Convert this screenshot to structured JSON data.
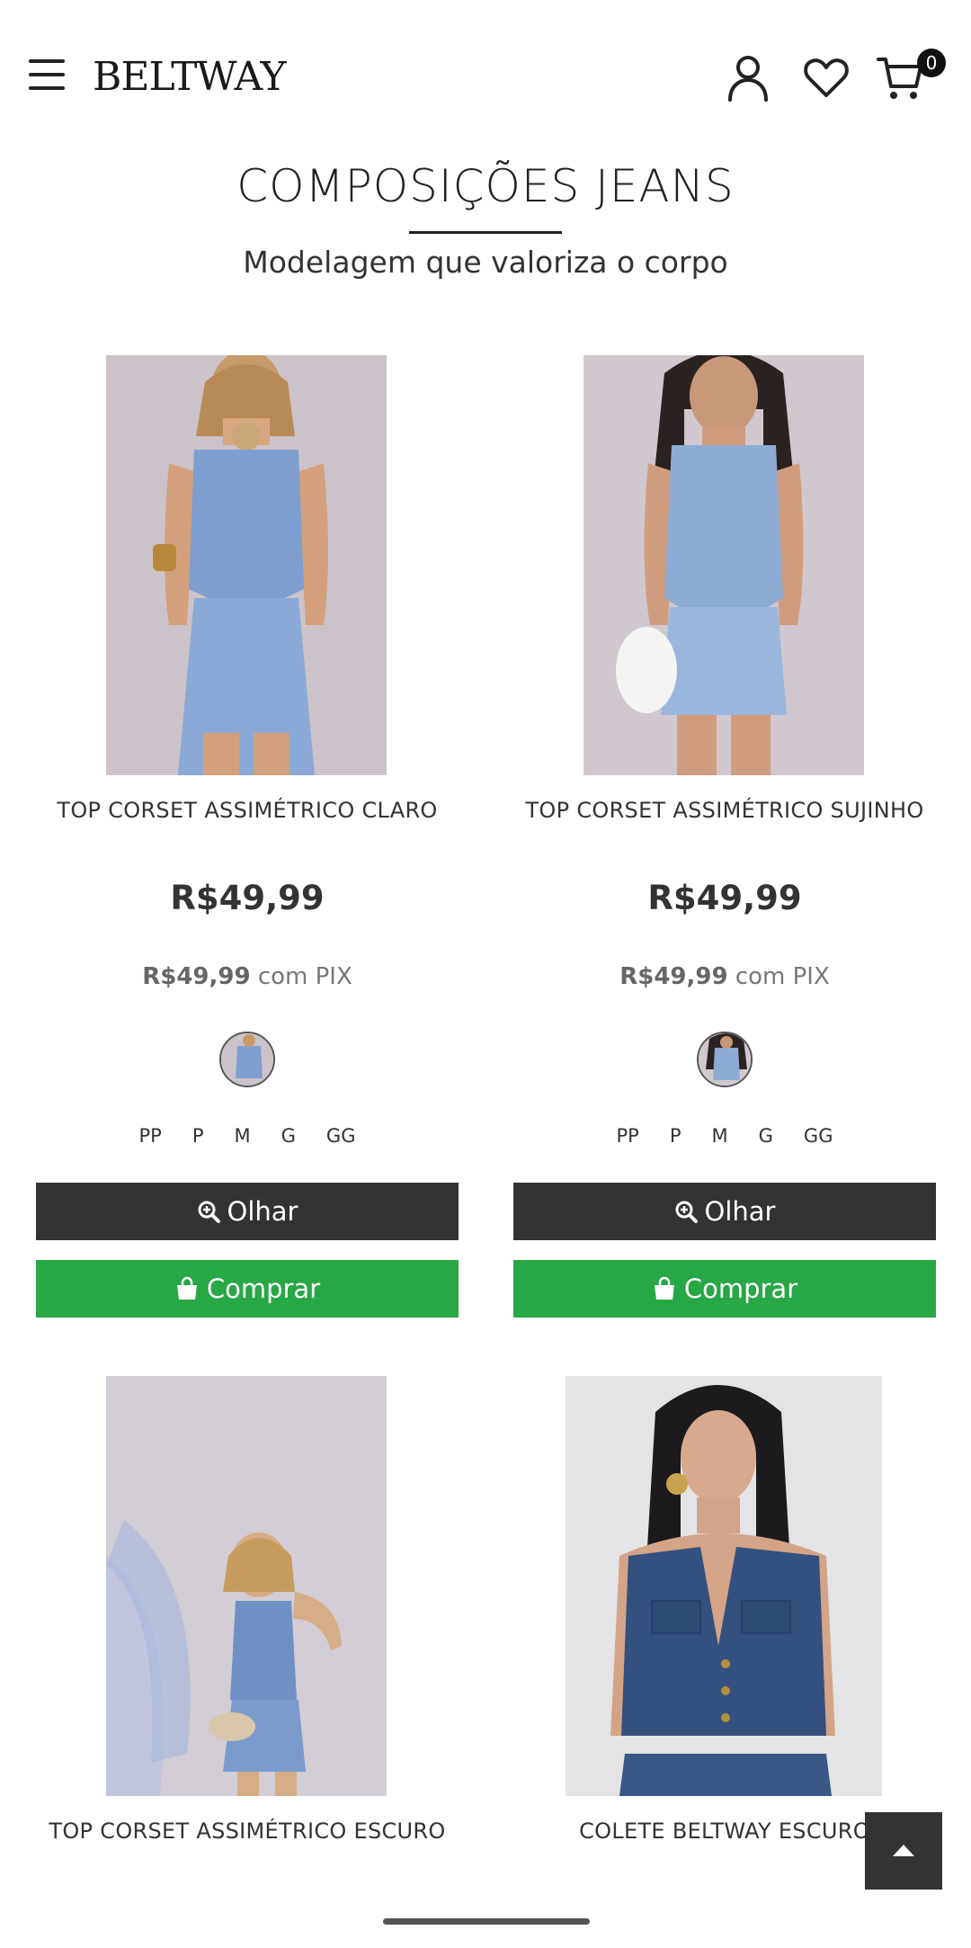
{
  "header": {
    "logo": "BELTWAY",
    "cart_count": "0"
  },
  "section": {
    "title": "COMPOSIÇÕES JEANS",
    "subtitle": "Modelagem que valoriza o corpo"
  },
  "products": [
    {
      "name": "TOP CORSET ASSIMÉTRICO CLARO",
      "price": "R$49,99",
      "pix_price": "R$49,99",
      "pix_suffix": "com PIX",
      "sizes": [
        "PP",
        "P",
        "M",
        "G",
        "GG"
      ],
      "olhar_label": "Olhar",
      "comprar_label": "Comprar"
    },
    {
      "name": "TOP CORSET ASSIMÉTRICO SUJINHO",
      "price": "R$49,99",
      "pix_price": "R$49,99",
      "pix_suffix": "com PIX",
      "sizes": [
        "PP",
        "P",
        "M",
        "G",
        "GG"
      ],
      "olhar_label": "Olhar",
      "comprar_label": "Comprar"
    },
    {
      "name": "TOP CORSET ASSIMÉTRICO ESCURO"
    },
    {
      "name": "COLETE BELTWAY ESCURO"
    }
  ],
  "colors": {
    "dark_button": "#333333",
    "buy_button": "#28a745",
    "denim_light": "#7e9fd0",
    "denim_dark": "#34507e"
  },
  "icons": [
    "menu-icon",
    "user-icon",
    "heart-icon",
    "cart-icon",
    "zoom-icon",
    "shopping-bag-icon",
    "arrow-up-icon"
  ]
}
